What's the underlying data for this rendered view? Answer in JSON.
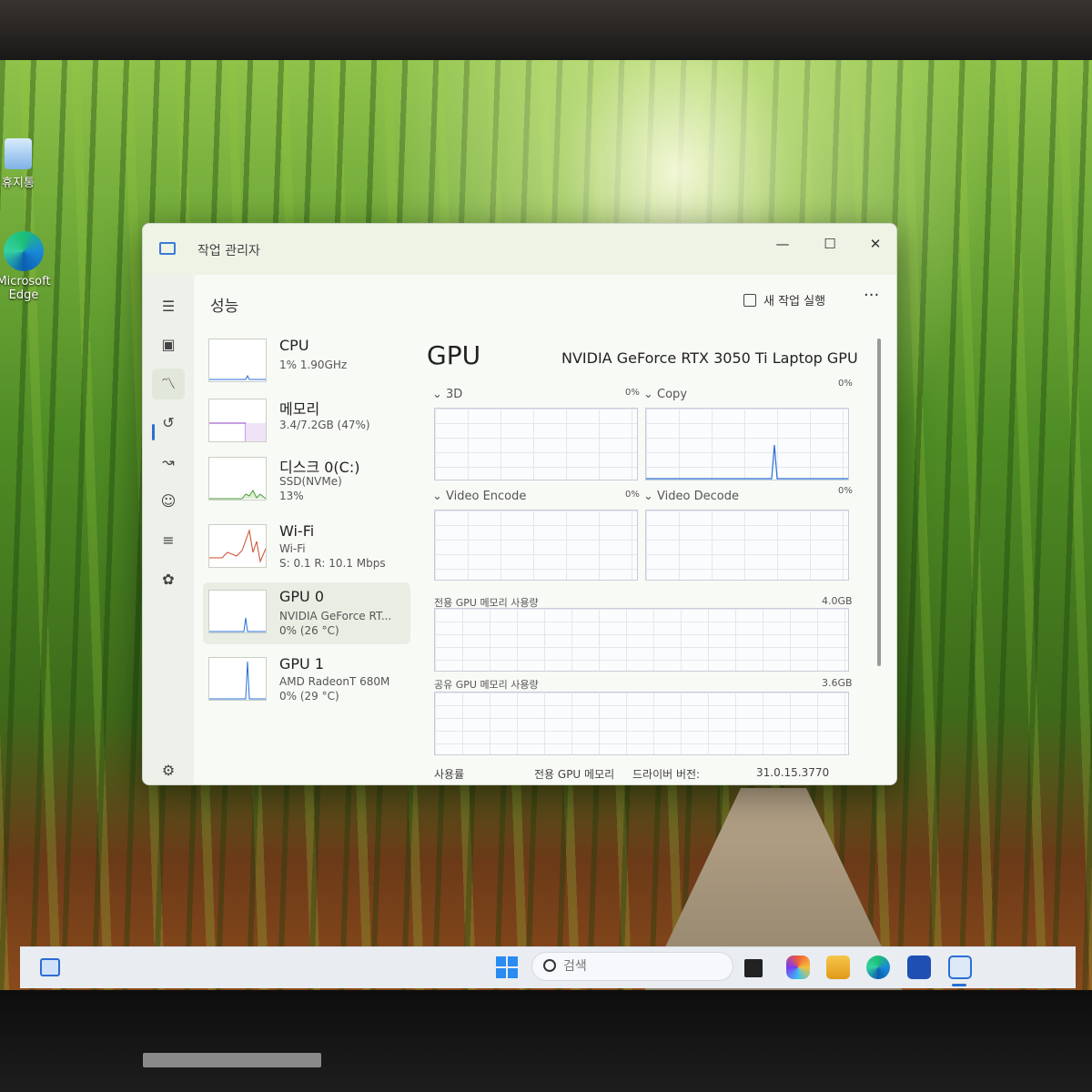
{
  "desktop": {
    "icons": [
      {
        "label": "휴지통"
      },
      {
        "label": "Microsoft Edge"
      }
    ]
  },
  "window": {
    "title": "작업 관리자",
    "controls": {
      "minimize": "—",
      "maximize": "☐",
      "close": "✕"
    }
  },
  "header": {
    "page_title": "성능",
    "run_task_label": "새 작업 실행",
    "more_label": "···"
  },
  "devices": [
    {
      "name": "CPU",
      "sub1": "1% 1.90GHz",
      "sub2": "",
      "sub3": ""
    },
    {
      "name": "메모리",
      "sub1": "3.4/7.2GB (47%)",
      "sub2": "",
      "sub3": ""
    },
    {
      "name": "디스크 0(C:)",
      "sub1": "SSD(NVMe)",
      "sub2": "13%",
      "sub3": ""
    },
    {
      "name": "Wi-Fi",
      "sub1": "Wi-Fi",
      "sub2": "S: 0.1  R: 10.1 Mbps",
      "sub3": ""
    },
    {
      "name": "GPU 0",
      "sub1": "NVIDIA GeForce RT...",
      "sub2": "0% (26 °C)",
      "sub3": ""
    },
    {
      "name": "GPU 1",
      "sub1": "AMD RadeonT 680M",
      "sub2": "0% (29 °C)",
      "sub3": ""
    }
  ],
  "detail": {
    "title": "GPU",
    "model": "NVIDIA GeForce RTX 3050 Ti Laptop GPU",
    "engines": [
      {
        "label": "3D",
        "value": "0%"
      },
      {
        "label": "Copy",
        "value": "0%"
      },
      {
        "label": "Video Encode",
        "value": "0%"
      },
      {
        "label": "Video Decode",
        "value": "0%"
      }
    ],
    "dedicated_memory": {
      "label": "전용 GPU 메모리 사용량",
      "max": "4.0GB"
    },
    "shared_memory": {
      "label": "공유 GPU 메모리 사용량",
      "max": "3.6GB"
    },
    "footer": {
      "usage_label": "사용률",
      "dedicated_label": "전용 GPU 메모리",
      "driver_label": "드라이버 버전:",
      "driver_version": "31.0.15.3770"
    }
  },
  "taskbar": {
    "search_placeholder": "검색"
  }
}
